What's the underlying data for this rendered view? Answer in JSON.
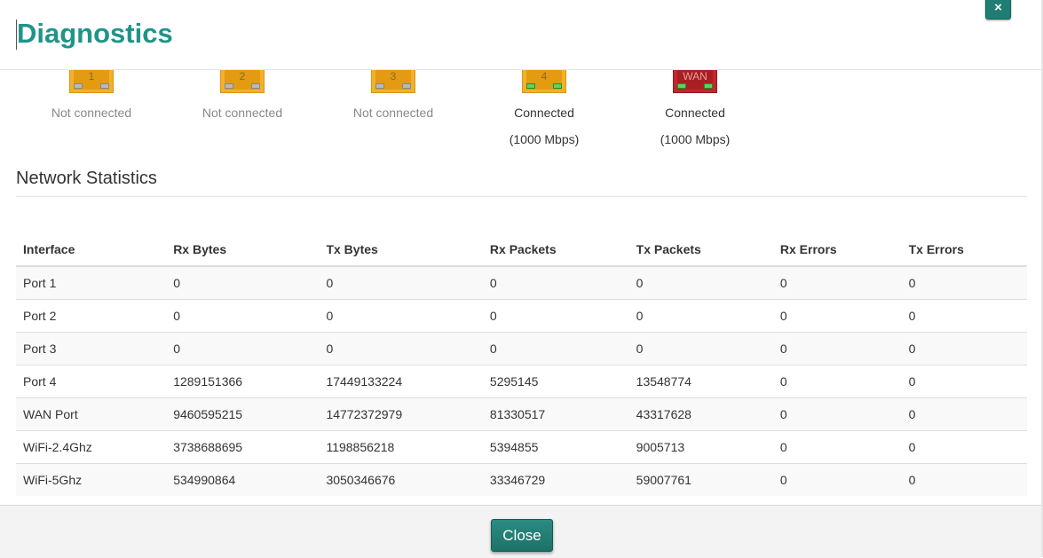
{
  "modal": {
    "title": "Diagnostics",
    "close_icon": "×",
    "close_label": "Close"
  },
  "ports": [
    {
      "label": "1",
      "status": "Not connected",
      "speed": "",
      "connected": false,
      "wan": false
    },
    {
      "label": "2",
      "status": "Not connected",
      "speed": "",
      "connected": false,
      "wan": false
    },
    {
      "label": "3",
      "status": "Not connected",
      "speed": "",
      "connected": false,
      "wan": false
    },
    {
      "label": "4",
      "status": "Connected",
      "speed": "(1000 Mbps)",
      "connected": true,
      "wan": false
    },
    {
      "label": "WAN",
      "status": "Connected",
      "speed": "(1000 Mbps)",
      "connected": true,
      "wan": true
    }
  ],
  "stats": {
    "title": "Network Statistics",
    "headers": [
      "Interface",
      "Rx Bytes",
      "Tx Bytes",
      "Rx Packets",
      "Tx Packets",
      "Rx Errors",
      "Tx Errors"
    ],
    "rows": [
      [
        "Port 1",
        "0",
        "0",
        "0",
        "0",
        "0",
        "0"
      ],
      [
        "Port 2",
        "0",
        "0",
        "0",
        "0",
        "0",
        "0"
      ],
      [
        "Port 3",
        "0",
        "0",
        "0",
        "0",
        "0",
        "0"
      ],
      [
        "Port 4",
        "1289151366",
        "17449133224",
        "5295145",
        "13548774",
        "0",
        "0"
      ],
      [
        "WAN Port",
        "9460595215",
        "14772372979",
        "81330517",
        "43317628",
        "0",
        "0"
      ],
      [
        "WiFi-2.4Ghz",
        "3738688695",
        "1198856218",
        "5394855",
        "9005713",
        "0",
        "0"
      ],
      [
        "WiFi-5Ghz",
        "534990864",
        "3050346676",
        "33346729",
        "59007761",
        "0",
        "0"
      ]
    ]
  },
  "colors": {
    "accent": "#1f9488",
    "button": "#1f7e74",
    "port_amber": "#f4b02a",
    "port_wan_red": "#c4262b",
    "led_on": "#5fd35f"
  }
}
